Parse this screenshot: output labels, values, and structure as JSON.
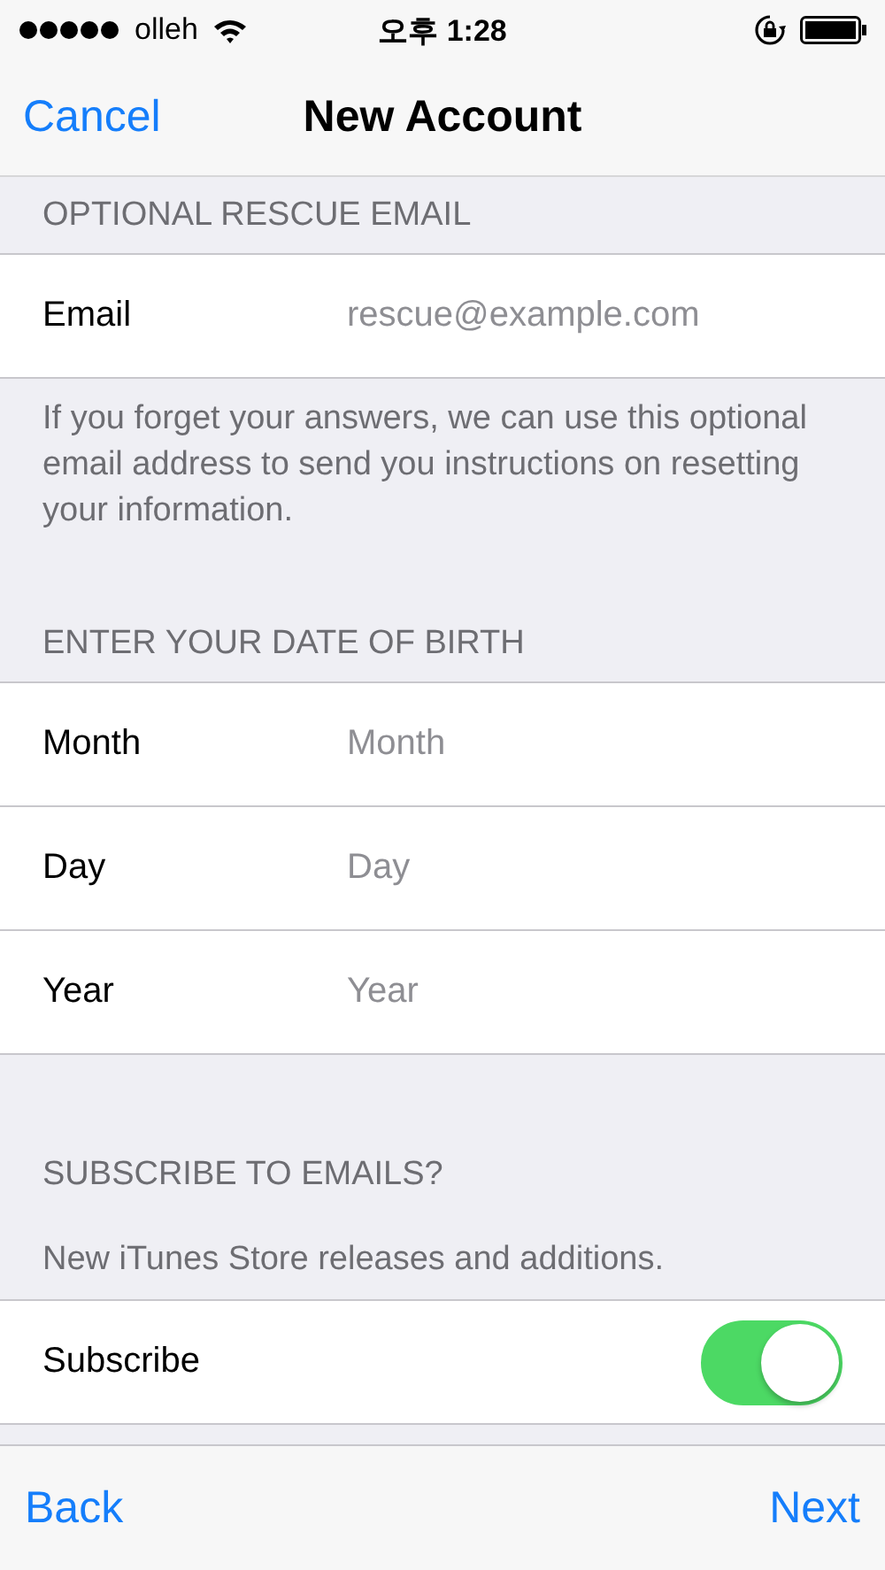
{
  "status_bar": {
    "carrier": "olleh",
    "time": "오후 1:28"
  },
  "nav_bar": {
    "left_button": "Cancel",
    "title": "New Account"
  },
  "sections": [
    {
      "header": "OPTIONAL RESCUE EMAIL",
      "fields": [
        {
          "label": "Email",
          "placeholder": "rescue@example.com"
        }
      ],
      "footer": "If you forget your answers, we can use this optional email address to send you instructions on resetting your information."
    },
    {
      "header": "ENTER YOUR DATE OF BIRTH",
      "fields": [
        {
          "label": "Month",
          "placeholder": "Month"
        },
        {
          "label": "Day",
          "placeholder": "Day"
        },
        {
          "label": "Year",
          "placeholder": "Year"
        }
      ]
    }
  ],
  "subscribe": {
    "header": "SUBSCRIBE TO EMAILS?",
    "note": "New iTunes Store releases and additions.",
    "label": "Subscribe",
    "on": true
  },
  "toolbar": {
    "left_button": "Back",
    "right_button": "Next"
  }
}
